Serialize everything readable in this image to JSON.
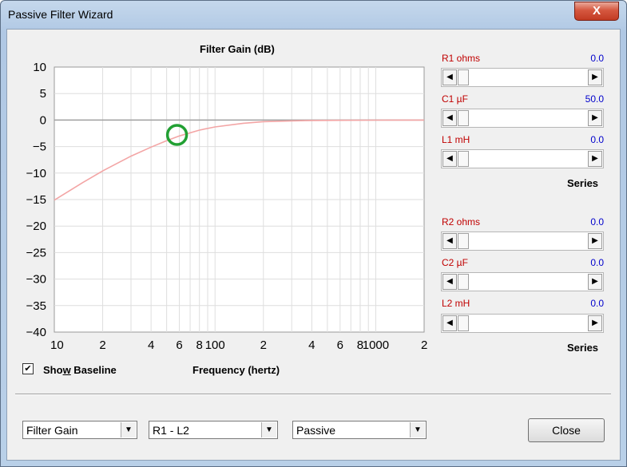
{
  "window": {
    "title": "Passive Filter Wizard",
    "close_glyph": "X"
  },
  "chart_data": {
    "type": "line",
    "title": "Filter Gain (dB)",
    "xlabel": "Frequency (hertz)",
    "ylabel": "",
    "xscale": "log",
    "xlim": [
      10,
      2000
    ],
    "ylim": [
      -40,
      10
    ],
    "grid": true,
    "yticks": [
      "10",
      "5",
      "0",
      "−15",
      "−10",
      "−15",
      "−20",
      "−25",
      "−30",
      "−35",
      "−40"
    ],
    "ytick_values": [
      10,
      5,
      0,
      -5,
      -10,
      -15,
      -20,
      -25,
      -30,
      -35,
      -40
    ],
    "ytick_labels": [
      "10",
      "5",
      "0",
      "−5",
      "−10",
      "−15",
      "−20",
      "−25",
      "−30",
      "−35",
      "−40"
    ],
    "xticks": [
      {
        "v": 10,
        "label": "10"
      },
      {
        "v": 20,
        "label": "2"
      },
      {
        "v": 40,
        "label": "4"
      },
      {
        "v": 60,
        "label": "6"
      },
      {
        "v": 80,
        "label": "8"
      },
      {
        "v": 100,
        "label": "100"
      },
      {
        "v": 200,
        "label": "2"
      },
      {
        "v": 400,
        "label": "4"
      },
      {
        "v": 600,
        "label": "6"
      },
      {
        "v": 800,
        "label": "8"
      },
      {
        "v": 1000,
        "label": "1000"
      },
      {
        "v": 2000,
        "label": "2"
      }
    ],
    "series": [
      {
        "type": "baseline",
        "x": [
          10,
          2000
        ],
        "y": [
          0,
          0
        ],
        "color": "#a0a0a0"
      },
      {
        "type": "gain",
        "color": "#f3a5a5",
        "x": [
          10,
          15,
          20,
          30,
          40,
          50,
          60,
          80,
          100,
          150,
          200,
          300,
          400,
          600,
          1000,
          2000
        ],
        "y": [
          -15.1,
          -11.8,
          -9.6,
          -6.8,
          -5.1,
          -3.9,
          -3.0,
          -1.9,
          -1.3,
          -0.6,
          -0.3,
          -0.15,
          -0.08,
          -0.04,
          -0.01,
          0.0
        ]
      }
    ],
    "marker": {
      "x": 58,
      "y": -2.8,
      "color": "#22a033"
    }
  },
  "series1": {
    "sliders": [
      {
        "label": "R1  ohms",
        "value": "0.0"
      },
      {
        "label": "C1  µF",
        "value": "50.0"
      },
      {
        "label": "L1  mH",
        "value": "0.0"
      }
    ],
    "caption": "Series"
  },
  "series2": {
    "sliders": [
      {
        "label": "R2  ohms",
        "value": "0.0"
      },
      {
        "label": "C2  µF",
        "value": "0.0"
      },
      {
        "label": "L2  mH",
        "value": "0.0"
      }
    ],
    "caption": "Series"
  },
  "baseline": {
    "label_pre": "Sho",
    "label_key": "w",
    "label_post": " Baseline",
    "checked": "✔"
  },
  "bottom": {
    "combo1": "Filter Gain",
    "combo2": "R1 - L2",
    "combo3": "Passive",
    "close": "Close"
  },
  "glyphs": {
    "left": "◀",
    "right": "▶",
    "down": "▼"
  }
}
